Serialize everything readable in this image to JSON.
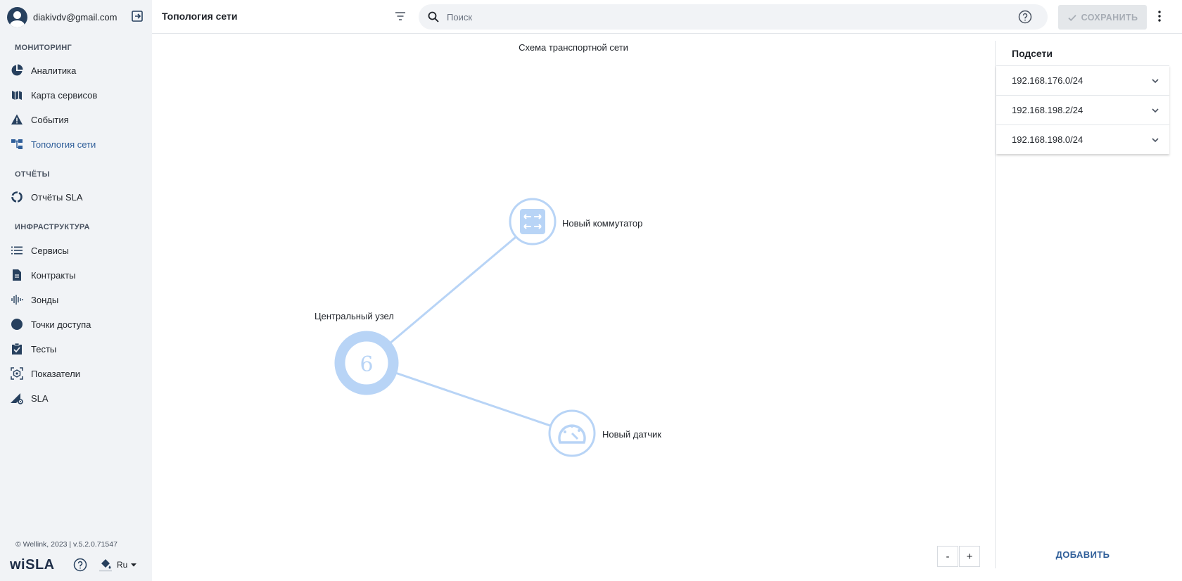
{
  "user": {
    "email": "diakivdv@gmail.com"
  },
  "sidebar": {
    "sections": [
      {
        "title": "МОНИТОРИНГ",
        "items": [
          {
            "label": "Аналитика",
            "icon": "pie-chart-icon"
          },
          {
            "label": "Карта сервисов",
            "icon": "map-icon"
          },
          {
            "label": "События",
            "icon": "warning-icon"
          },
          {
            "label": "Топология сети",
            "icon": "topology-icon",
            "active": true
          }
        ]
      },
      {
        "title": "ОТЧЁТЫ",
        "items": [
          {
            "label": "Отчёты SLA",
            "icon": "report-circle-icon"
          }
        ]
      },
      {
        "title": "ИНФРАСТРУКТУРА",
        "items": [
          {
            "label": "Сервисы",
            "icon": "list-icon"
          },
          {
            "label": "Контракты",
            "icon": "document-icon"
          },
          {
            "label": "Зонды",
            "icon": "waveform-icon"
          },
          {
            "label": "Точки доступа",
            "icon": "dot-icon"
          },
          {
            "label": "Тесты",
            "icon": "clipboard-check-icon"
          },
          {
            "label": "Показатели",
            "icon": "metrics-icon"
          },
          {
            "label": "SLA",
            "icon": "sla-gear-icon"
          }
        ]
      }
    ],
    "footer": {
      "copyright": "© Wellink, 2023 | v.5.2.0.71547",
      "logo": "wiSLA",
      "language": "Ru"
    }
  },
  "topbar": {
    "title": "Топология сети",
    "search_placeholder": "Поиск",
    "save_label": "СОХРАНИТЬ"
  },
  "canvas": {
    "title": "Схема транспортной сети",
    "nodes": {
      "central": {
        "label": "Центральный узел",
        "count": "6"
      },
      "switch": {
        "label": "Новый коммутатор"
      },
      "sensor": {
        "label": "Новый датчик"
      }
    },
    "zoom_out": "-",
    "zoom_in": "+"
  },
  "panel": {
    "title": "Подсети",
    "subnets": [
      "192.168.176.0/24",
      "192.168.198.2/24",
      "192.168.198.0/24"
    ],
    "add_label": "ДОБАВИТЬ"
  },
  "colors": {
    "accent": "#2f5e99",
    "node": "#b8d4f6",
    "sidebar_bg": "#f1f3f6"
  }
}
